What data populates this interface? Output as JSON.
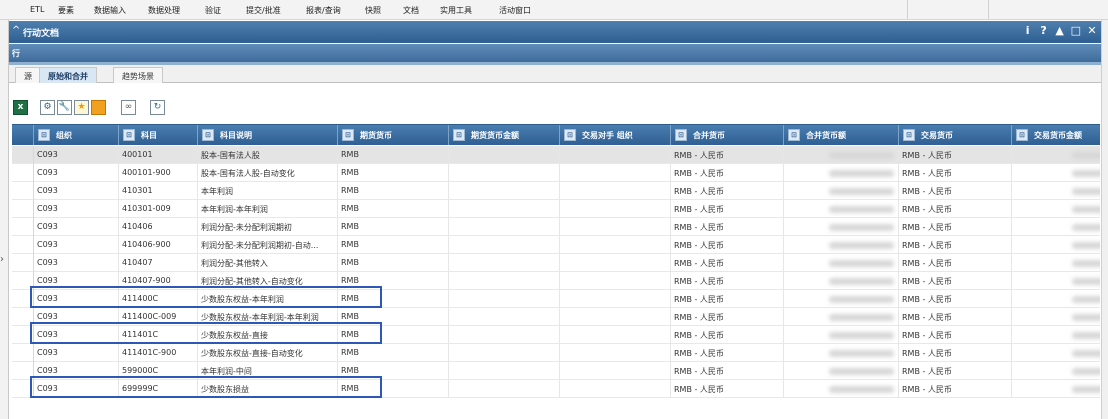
{
  "menu": [
    "ETL",
    "要素",
    "数据输入",
    "数据处理",
    "验证",
    "提交/批准",
    "报表/查询",
    "快照",
    "文档",
    "实用工具",
    "活动窗口"
  ],
  "window": {
    "title": "行动文档",
    "controls": [
      "i",
      "?",
      "▲",
      "□",
      "✕"
    ]
  },
  "row_header": "行",
  "tabs": [
    "源",
    "原始和合并",
    "趋势场景"
  ],
  "active_tab": 1,
  "toolbar": {
    "icons": [
      "excel-icon",
      "gear-icon",
      "wrench-icon",
      "star-icon",
      "orange-square-icon",
      "link-icon",
      "refresh-icon"
    ]
  },
  "grid": {
    "columns": [
      "组织",
      "科目",
      "科目说明",
      "期货货币",
      "期货货币金额",
      "交易对手 组织",
      "合并货币",
      "合并货币额",
      "交易货币",
      "交易货币金额"
    ],
    "rows": [
      {
        "org": "C093",
        "acct": "400101",
        "desc": "股本-国有法人股",
        "cur": "RMB",
        "cons": "RMB - 人民币",
        "tx": "RMB - 人民币"
      },
      {
        "org": "C093",
        "acct": "400101-900",
        "desc": "股本-国有法人股-自动变化",
        "cur": "RMB",
        "cons": "RMB - 人民币",
        "tx": "RMB - 人民币"
      },
      {
        "org": "C093",
        "acct": "410301",
        "desc": "本年利润",
        "cur": "RMB",
        "cons": "RMB - 人民币",
        "tx": "RMB - 人民币"
      },
      {
        "org": "C093",
        "acct": "410301-009",
        "desc": "本年利润-本年利润",
        "cur": "RMB",
        "cons": "RMB - 人民币",
        "tx": "RMB - 人民币"
      },
      {
        "org": "C093",
        "acct": "410406",
        "desc": "利润分配-未分配利润期初",
        "cur": "RMB",
        "cons": "RMB - 人民币",
        "tx": "RMB - 人民币"
      },
      {
        "org": "C093",
        "acct": "410406-900",
        "desc": "利润分配-未分配利润期初-自动...",
        "cur": "RMB",
        "cons": "RMB - 人民币",
        "tx": "RMB - 人民币"
      },
      {
        "org": "C093",
        "acct": "410407",
        "desc": "利润分配-其他转入",
        "cur": "RMB",
        "cons": "RMB - 人民币",
        "tx": "RMB - 人民币"
      },
      {
        "org": "C093",
        "acct": "410407-900",
        "desc": "利润分配-其他转入-自动变化",
        "cur": "RMB",
        "cons": "RMB - 人民币",
        "tx": "RMB - 人民币"
      },
      {
        "org": "C093",
        "acct": "411400C",
        "desc": "少数股东权益-本年利润",
        "cur": "RMB",
        "cons": "RMB - 人民币",
        "tx": "RMB - 人民币"
      },
      {
        "org": "C093",
        "acct": "411400C-009",
        "desc": "少数股东权益-本年利润-本年利润",
        "cur": "RMB",
        "cons": "RMB - 人民币",
        "tx": "RMB - 人民币"
      },
      {
        "org": "C093",
        "acct": "411401C",
        "desc": "少数股东权益-直接",
        "cur": "RMB",
        "cons": "RMB - 人民币",
        "tx": "RMB - 人民币"
      },
      {
        "org": "C093",
        "acct": "411401C-900",
        "desc": "少数股东权益-直接-自动变化",
        "cur": "RMB",
        "cons": "RMB - 人民币",
        "tx": "RMB - 人民币"
      },
      {
        "org": "C093",
        "acct": "599000C",
        "desc": "本年利润-中间",
        "cur": "RMB",
        "cons": "RMB - 人民币",
        "tx": "RMB - 人民币"
      },
      {
        "org": "C093",
        "acct": "699999C",
        "desc": "少数股东损益",
        "cur": "RMB",
        "cons": "RMB - 人民币",
        "tx": "RMB - 人民币"
      }
    ],
    "selected_row": 0,
    "highlighted_rows": [
      8,
      10,
      13
    ]
  },
  "colors": {
    "header_blue": "#2f5f93",
    "highlight_outline": "#2e58b8",
    "selected_row": "#e4e4e4"
  }
}
